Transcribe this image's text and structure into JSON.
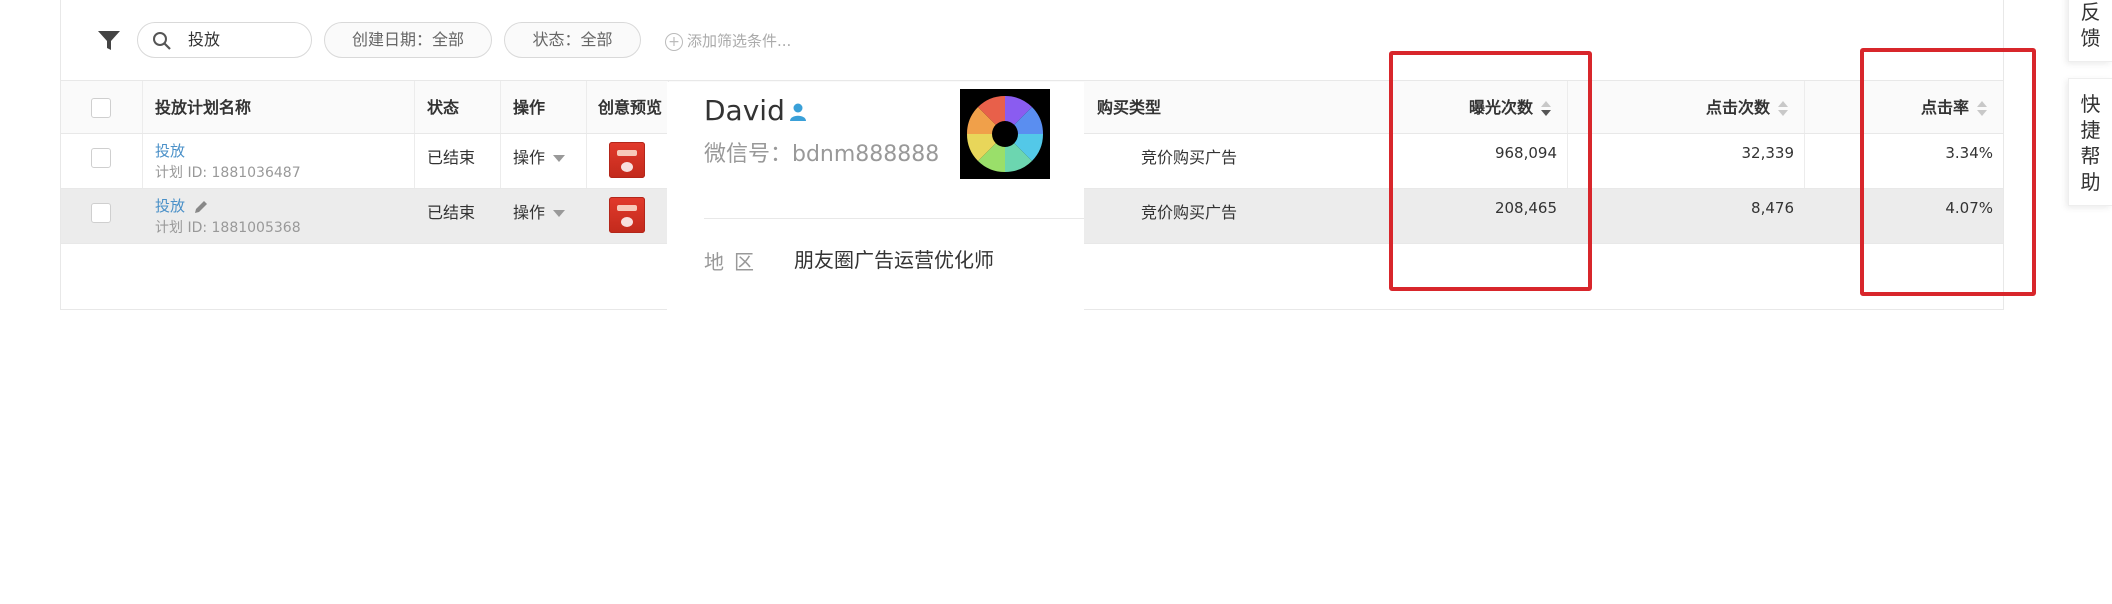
{
  "filters": {
    "search_value": "投放",
    "date_pill": "创建日期：全部",
    "status_pill": "状态：全部",
    "add_condition": "添加筛选条件..."
  },
  "table": {
    "headers": {
      "name": "投放计划名称",
      "status": "状态",
      "action": "操作",
      "creative": "创意预览",
      "buy_type": "购买类型",
      "impressions": "曝光次数",
      "clicks": "点击次数",
      "ctr": "点击率"
    },
    "rows": [
      {
        "name": "投放",
        "plan_id": "计划 ID: 1881036487",
        "status": "已结束",
        "action": "操作",
        "buy_type": "竞价购买广告",
        "impressions": "968,094",
        "clicks": "32,339",
        "ctr": "3.34%"
      },
      {
        "name": "投放",
        "plan_id": "计划 ID: 1881005368",
        "status": "已结束",
        "action": "操作",
        "buy_type": "竞价购买广告",
        "impressions": "208,465",
        "clicks": "8,476",
        "ctr": "4.07%"
      }
    ]
  },
  "card": {
    "name": "David",
    "wechat": "微信号：bdnm888888",
    "region_label": "地区",
    "region_value": "朋友圈广告运营优化师"
  },
  "side": {
    "feedback": [
      "反",
      "馈"
    ],
    "help": [
      "快",
      "捷",
      "帮",
      "助"
    ]
  },
  "colors": {
    "link": "#4a90c8",
    "highlight_box": "#d8262b"
  }
}
